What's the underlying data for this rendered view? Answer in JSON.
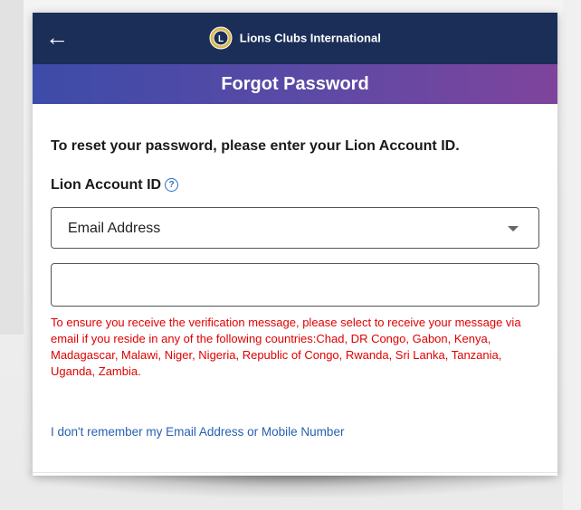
{
  "header": {
    "back_label": "←",
    "brand_name": "Lions Clubs International",
    "logo_letter": "L"
  },
  "title": "Forgot Password",
  "main": {
    "instruction": "To reset your password, please enter your Lion Account ID.",
    "field_label": "Lion Account ID",
    "help_icon_glyph": "?",
    "select_value": "Email Address",
    "input_value": "",
    "warning": "To ensure you receive the verification message, please select to receive your message via email if you reside in any of the following countries:Chad, DR Congo, Gabon, Kenya, Madagascar, Malawi, Niger, Nigeria, Republic of Congo, Rwanda, Sri Lanka, Tanzania, Uganda, Zambia.",
    "help_link": "I don't remember my Email Address or Mobile Number"
  },
  "colors": {
    "header_bg": "#1b2e58",
    "gradient_start": "#3d4ba8",
    "gradient_end": "#7f449c",
    "warning_text": "#e00000",
    "link_text": "#2860b0"
  }
}
